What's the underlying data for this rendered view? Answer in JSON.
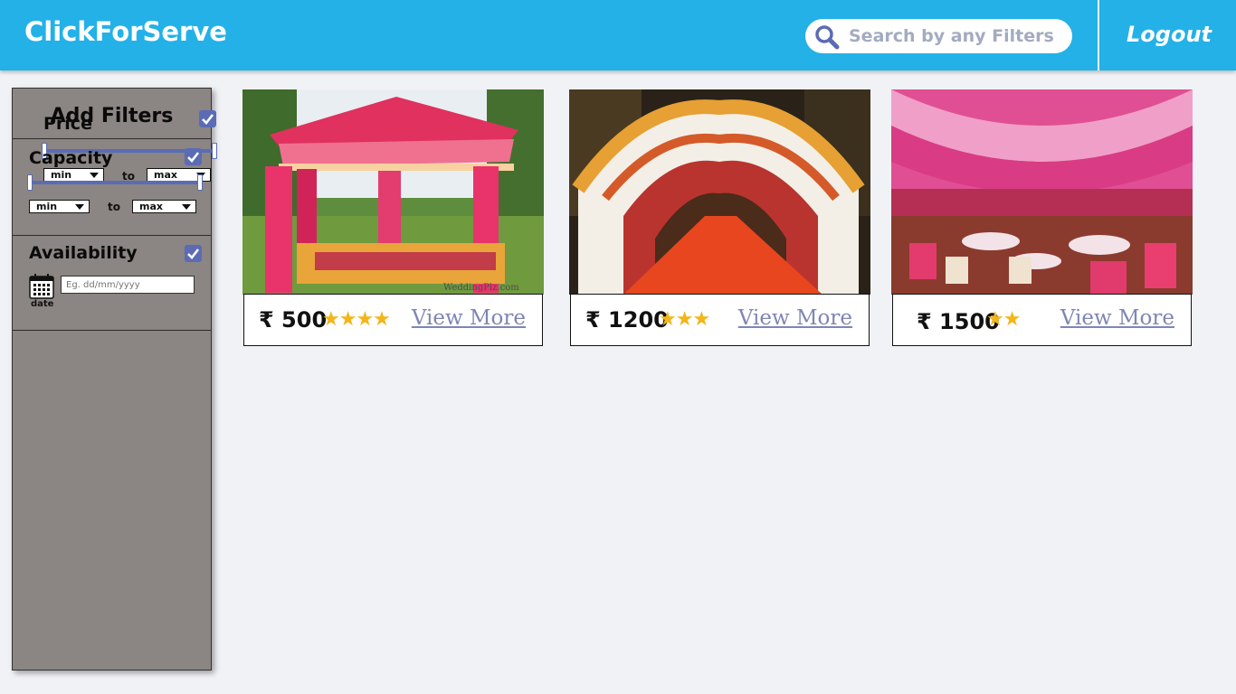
{
  "header": {
    "brand": "ClickForServe",
    "search_placeholder": "Search by any Filters",
    "logout_label": "Logout"
  },
  "sidebar": {
    "title": "Add Filters",
    "price": {
      "label": "Price",
      "checked": true,
      "min_label": "min",
      "to_label": "to",
      "max_label": "max"
    },
    "capacity": {
      "label": "Capacity",
      "checked": true,
      "min_label": "min",
      "to_label": "to",
      "max_label": "max"
    },
    "availability": {
      "label": "Availability",
      "checked": true,
      "date_label": "date",
      "date_placeholder": "Eg. dd/mm/yyyy"
    }
  },
  "cards": [
    {
      "price": "₹ 500",
      "rating": 4,
      "stars": "★★★★",
      "link": "View More",
      "image": "pink-canopy-tent"
    },
    {
      "price": "₹ 1200",
      "rating": 3,
      "stars": "★★★",
      "link": "View More",
      "image": "floral-entrance-red-carpet"
    },
    {
      "price": "₹ 1500",
      "rating": 2,
      "stars": "★★",
      "link": "View More",
      "image": "pink-draped-banquet-hall"
    }
  ],
  "watermark": "WeddingPlz.com",
  "colors": {
    "header": "#23b1e8",
    "sidebar": "#8b8583",
    "accent": "#5b6bb5",
    "star": "#f3b519",
    "link": "#7f86b4"
  }
}
